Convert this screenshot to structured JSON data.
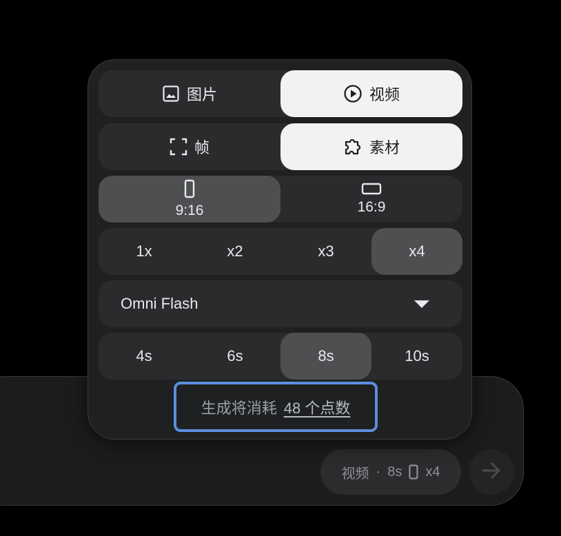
{
  "popup": {
    "mode_tabs": [
      {
        "label": "图片",
        "icon": "image-icon",
        "selected": false
      },
      {
        "label": "视频",
        "icon": "play-circle-icon",
        "selected": true
      }
    ],
    "source_tabs": [
      {
        "label": "帧",
        "icon": "frame-corners-icon",
        "selected": false
      },
      {
        "label": "素材",
        "icon": "puzzle-icon",
        "selected": true
      }
    ],
    "aspect_ratios": [
      {
        "label": "9:16",
        "icon": "portrait-rect-icon",
        "selected": true
      },
      {
        "label": "16:9",
        "icon": "landscape-rect-icon",
        "selected": false
      }
    ],
    "counts": [
      {
        "label": "1x",
        "selected": false
      },
      {
        "label": "x2",
        "selected": false
      },
      {
        "label": "x3",
        "selected": false
      },
      {
        "label": "x4",
        "selected": true
      }
    ],
    "model": {
      "selected": "Omni Flash"
    },
    "durations": [
      {
        "label": "4s",
        "selected": false
      },
      {
        "label": "6s",
        "selected": false
      },
      {
        "label": "8s",
        "selected": true
      },
      {
        "label": "10s",
        "selected": false
      }
    ],
    "cost": {
      "prefix": "生成将消耗",
      "amount": "48 个点数"
    }
  },
  "composer": {
    "chip": {
      "mode": "视频",
      "separator": "·",
      "duration": "8s",
      "count": "x4"
    },
    "send_icon": "arrow-right-icon"
  },
  "colors": {
    "background": "#000000",
    "panel": "#1f2021",
    "segment_bg": "#2a2b2c",
    "selected_white": "#f1f2f4",
    "selected_grey": "#4e4f51",
    "focus_ring": "#5b8fdd"
  }
}
